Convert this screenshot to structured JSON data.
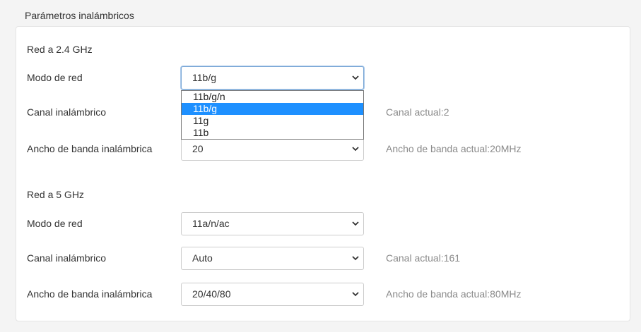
{
  "page": {
    "section_title": "Parámetros inalámbricos"
  },
  "band24": {
    "title": "Red a 2.4 GHz",
    "mode_label": "Modo de red",
    "mode_value": "11b/g",
    "mode_options": [
      "11b/g/n",
      "11b/g",
      "11g",
      "11b"
    ],
    "mode_selected_index": 1,
    "channel_label": "Canal inalámbrico",
    "channel_current": "Canal actual:2",
    "bandwidth_label": "Ancho de banda inalámbrica",
    "bandwidth_value": "20",
    "bandwidth_current": "Ancho de banda actual:20MHz"
  },
  "band5": {
    "title": "Red a 5 GHz",
    "mode_label": "Modo de red",
    "mode_value": "11a/n/ac",
    "channel_label": "Canal inalámbrico",
    "channel_value": "Auto",
    "channel_current": "Canal actual:161",
    "bandwidth_label": "Ancho de banda inalámbrica",
    "bandwidth_value": "20/40/80",
    "bandwidth_current": "Ancho de banda actual:80MHz"
  },
  "icons": {
    "select_arrow": "chevron-down-icon"
  },
  "colors": {
    "selected_option_bg": "#1e90ff",
    "hint_text": "#8a8a8a"
  }
}
